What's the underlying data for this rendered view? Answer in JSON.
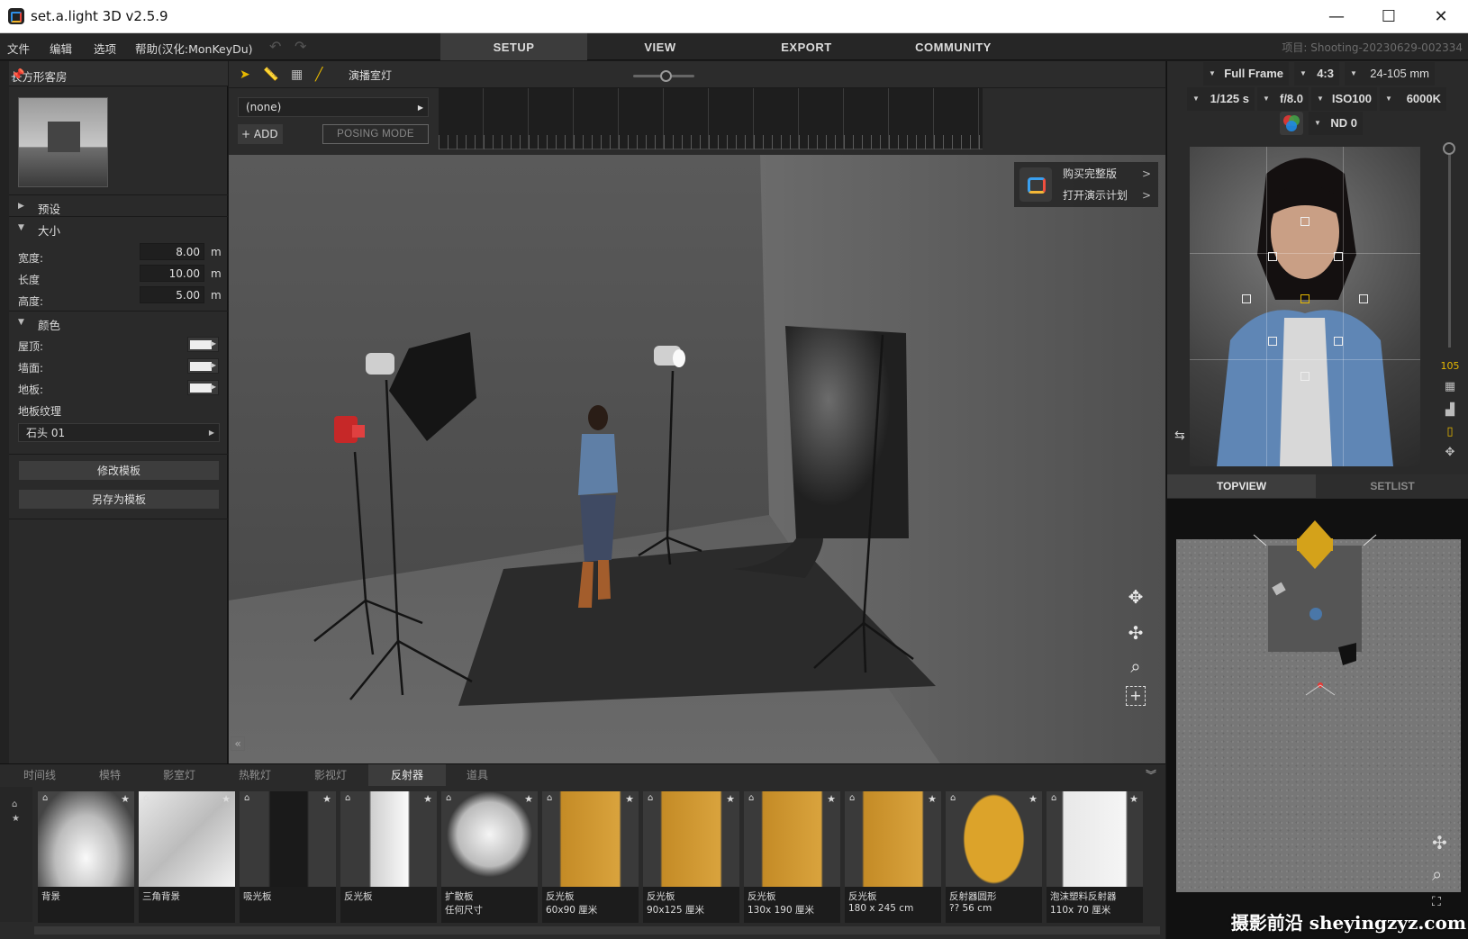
{
  "window": {
    "title": "set.a.light 3D v2.5.9",
    "minimize": "—",
    "maximize": "☐",
    "close": "✕"
  },
  "menu": {
    "items": [
      "文件",
      "编辑",
      "选项",
      "帮助(汉化:MonKeyDu)"
    ],
    "undo": "↶",
    "redo": "↷"
  },
  "main_tabs": [
    "SETUP",
    "VIEW",
    "EXPORT",
    "COMMUNITY"
  ],
  "active_tab": "SETUP",
  "project_label": "项目: Shooting-20230629-002334",
  "left_panel": {
    "title": "长方形客房",
    "preset_header": "预设",
    "size_header": "大小",
    "width_label": "宽度:",
    "width_value": "8.00",
    "length_label": "长度",
    "length_value": "10.00",
    "height_label": "高度:",
    "height_value": "5.00",
    "unit": "m",
    "color_header": "颜色",
    "ceiling_label": "屋顶:",
    "wall_label": "墙面:",
    "floor_label": "地板:",
    "floor_texture_label": "地板纹理",
    "floor_texture_value": "石头 01",
    "modify_template": "修改模板",
    "save_as_template": "另存为模板"
  },
  "toolstrip": {
    "studio_light_label": "演播室灯",
    "studio_light_level": 0.55
  },
  "timeline": {
    "animation_value": "(none)",
    "add_label": "+ ADD",
    "posing_mode": "POSING MODE"
  },
  "viewport_promo": {
    "buy_full": "购买完整版",
    "open_demo": "打开演示计划",
    "arrow": ">"
  },
  "camera": {
    "sensor": "Full Frame",
    "ratio": "4:3",
    "lens": "24-105 mm",
    "shutter": "1/125 s",
    "aperture": "f/8.0",
    "iso": "ISO100",
    "wb": "6000K",
    "nd": "ND 0"
  },
  "preview_side": {
    "focal": "105"
  },
  "right_tabs": [
    "TOPVIEW",
    "SETLIST"
  ],
  "active_right_tab": "TOPVIEW",
  "bottom_tabs": [
    "时间线",
    "模特",
    "影室灯",
    "热靴灯",
    "影视灯",
    "反射器",
    "道具"
  ],
  "active_bottom_tab": "反射器",
  "library": [
    {
      "name": "背景",
      "sub": ""
    },
    {
      "name": "三角背景",
      "sub": ""
    },
    {
      "name": "吸光板",
      "sub": ""
    },
    {
      "name": "反光板",
      "sub": ""
    },
    {
      "name": "扩散板",
      "sub": "任何尺寸"
    },
    {
      "name": "反光板",
      "sub": "60x90 厘米"
    },
    {
      "name": "反光板",
      "sub": "90x125 厘米"
    },
    {
      "name": "反光板",
      "sub": "130x 190 厘米"
    },
    {
      "name": "反光板",
      "sub": "180 x 245 cm"
    },
    {
      "name": "反射器圆形",
      "sub": "?? 56 cm"
    },
    {
      "name": "泡沫塑料反射器",
      "sub": "110x 70 厘米"
    }
  ],
  "watermark": "摄影前沿 sheyingzyz.com",
  "colors": {
    "accent": "#e6b800",
    "panel": "#2a2a2a",
    "viewport": "#4e4e4e"
  }
}
